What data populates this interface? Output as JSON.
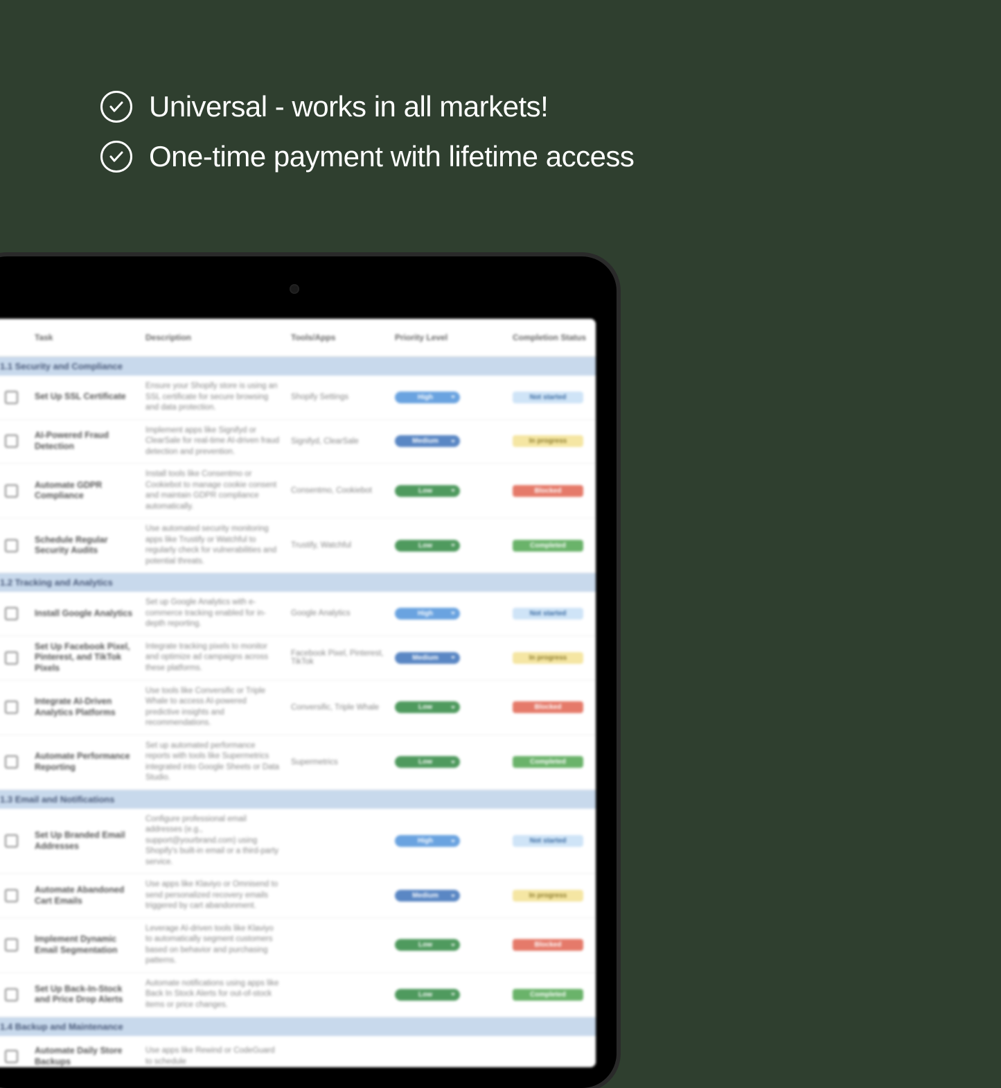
{
  "features": [
    "Universal - works in all markets!",
    "One-time payment with lifetime access"
  ],
  "sheet": {
    "headers": {
      "check": "",
      "task": "Task",
      "description": "Description",
      "tools": "Tools/Apps",
      "priority": "Priority Level",
      "status": "Completion Status"
    },
    "sections": [
      {
        "title": "1.1 Security and Compliance",
        "rows": [
          {
            "task": "Set Up SSL Certificate",
            "description": "Ensure your Shopify store is using an SSL certificate for secure browsing and data protection.",
            "tools": "Shopify Settings",
            "priority": "High",
            "priority_class": "high",
            "status": "Not started",
            "status_class": "notstarted"
          },
          {
            "task": "AI-Powered Fraud Detection",
            "description": "Implement apps like Signifyd or ClearSale for real-time AI-driven fraud detection and prevention.",
            "tools": "Signifyd, ClearSale",
            "priority": "Medium",
            "priority_class": "medium",
            "status": "In progress",
            "status_class": "inprogress"
          },
          {
            "task": "Automate GDPR Compliance",
            "description": "Install tools like Consentmo or Cookiebot to manage cookie consent and maintain GDPR compliance automatically.",
            "tools": "Consentmo, Cookiebot",
            "priority": "Low",
            "priority_class": "low",
            "status": "Blocked",
            "status_class": "blocked"
          },
          {
            "task": "Schedule Regular Security Audits",
            "description": "Use automated security monitoring apps like Trustify or Watchful to regularly check for vulnerabilities and potential threats.",
            "tools": "Trustify, Watchful",
            "priority": "Low",
            "priority_class": "low2",
            "status": "Completed",
            "status_class": "completed"
          }
        ]
      },
      {
        "title": "1.2 Tracking and Analytics",
        "rows": [
          {
            "task": "Install Google Analytics",
            "description": "Set up Google Analytics with e-commerce tracking enabled for in-depth reporting.",
            "tools": "Google Analytics",
            "priority": "High",
            "priority_class": "high",
            "status": "Not started",
            "status_class": "notstarted"
          },
          {
            "task": "Set Up Facebook Pixel, Pinterest, and TikTok Pixels",
            "description": "Integrate tracking pixels to monitor and optimize ad campaigns across these platforms.",
            "tools": "Facebook Pixel, Pinterest, TikTok",
            "priority": "Medium",
            "priority_class": "medium",
            "status": "In progress",
            "status_class": "inprogress"
          },
          {
            "task": "Integrate AI-Driven Analytics Platforms",
            "description": "Use tools like Conversific or Triple Whale to access AI-powered predictive insights and recommendations.",
            "tools": "Conversific, Triple Whale",
            "priority": "Low",
            "priority_class": "low",
            "status": "Blocked",
            "status_class": "blocked"
          },
          {
            "task": "Automate Performance Reporting",
            "description": "Set up automated performance reports with tools like Supermetrics integrated into Google Sheets or Data Studio.",
            "tools": "Supermetrics",
            "priority": "Low",
            "priority_class": "low2",
            "status": "Completed",
            "status_class": "completed"
          }
        ]
      },
      {
        "title": "1.3 Email and Notifications",
        "rows": [
          {
            "task": "Set Up Branded Email Addresses",
            "description": "Configure professional email addresses (e.g., support@yourbrand.com) using Shopify's built-in email or a third-party service.",
            "tools": "",
            "priority": "High",
            "priority_class": "high",
            "status": "Not started",
            "status_class": "notstarted"
          },
          {
            "task": "Automate Abandoned Cart Emails",
            "description": "Use apps like Klaviyo or Omnisend to send personalized recovery emails triggered by cart abandonment.",
            "tools": "",
            "priority": "Medium",
            "priority_class": "medium",
            "status": "In progress",
            "status_class": "inprogress"
          },
          {
            "task": "Implement Dynamic Email Segmentation",
            "description": "Leverage AI-driven tools like Klaviyo to automatically segment customers based on behavior and purchasing patterns.",
            "tools": "",
            "priority": "Low",
            "priority_class": "low",
            "status": "Blocked",
            "status_class": "blocked"
          },
          {
            "task": "Set Up Back-In-Stock and Price Drop Alerts",
            "description": "Automate notifications using apps like Back In Stock Alerts for out-of-stock items or price changes.",
            "tools": "",
            "priority": "Low",
            "priority_class": "low2",
            "status": "Completed",
            "status_class": "completed"
          }
        ]
      },
      {
        "title": "1.4 Backup and Maintenance",
        "rows": [
          {
            "task": "Automate Daily Store Backups",
            "description": "Use apps like Rewind or CodeGuard to schedule",
            "tools": "",
            "priority": "",
            "priority_class": "",
            "status": "",
            "status_class": ""
          }
        ]
      }
    ]
  }
}
